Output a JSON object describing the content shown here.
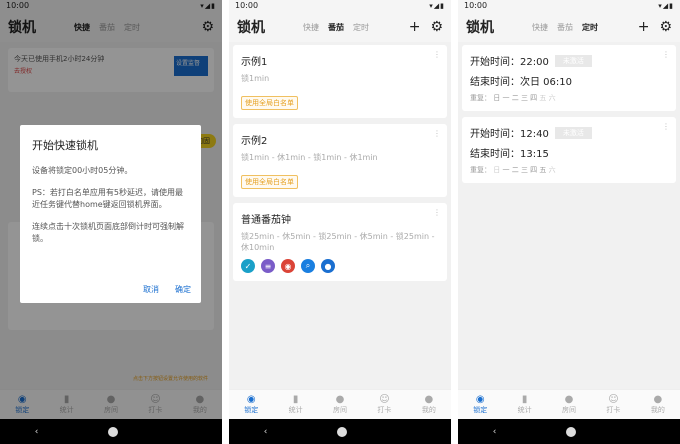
{
  "status": {
    "time": "10:00",
    "icons": "▾◢▮"
  },
  "app": {
    "title": "锁机",
    "tabs": [
      "快捷",
      "番茄",
      "定时"
    ],
    "add_label": "+",
    "settings_icon": "gear-icon"
  },
  "bottom_tabs": [
    "锁定",
    "统计",
    "房间",
    "打卡",
    "我的"
  ],
  "nav": {
    "back": "‹"
  },
  "panel1": {
    "usage_text": "今天已使用手机2小时24分钟",
    "usage_warn": "去授权",
    "setting_btn": "设置监督",
    "shield_label": "权限加固",
    "hint": "点击下方按钮设置允许使用的软件",
    "dialog": {
      "title": "开始快速锁机",
      "line1": "设备将锁定00小时05分钟。",
      "line2": "PS：若打白名单应用有5秒延迟，请使用最近任务键代替home键返回锁机界面。",
      "line3": "连续点击十次锁机页面底部倒计时可强制解锁。",
      "cancel": "取消",
      "confirm": "确定"
    }
  },
  "panel2": {
    "cards": [
      {
        "title": "示例1",
        "desc": "锁1min",
        "tag": "使用全局白名单"
      },
      {
        "title": "示例2",
        "desc": "锁1min - 休1min - 锁1min - 休1min",
        "tag": "使用全局白名单"
      },
      {
        "title": "普通番茄钟",
        "desc": "锁25min - 休5min - 锁25min - 休5min - 锁25min - 休10min"
      }
    ]
  },
  "panel3": {
    "schedules": [
      {
        "start_label": "开始时间：22:00",
        "badge": "未激活",
        "end_label": "结束时间：次日 06:10",
        "repeat": "重复：",
        "days": [
          "日",
          "一",
          "二",
          "三",
          "四",
          "五",
          "六"
        ]
      },
      {
        "start_label": "开始时间：12:40",
        "badge": "未激活",
        "end_label": "结束时间：13:15",
        "repeat": "重复：",
        "days": [
          "日",
          "一",
          "二",
          "三",
          "四",
          "五",
          "六"
        ]
      }
    ]
  },
  "colors": {
    "accent": "#1a6fd0",
    "tag": "#e6a020"
  }
}
